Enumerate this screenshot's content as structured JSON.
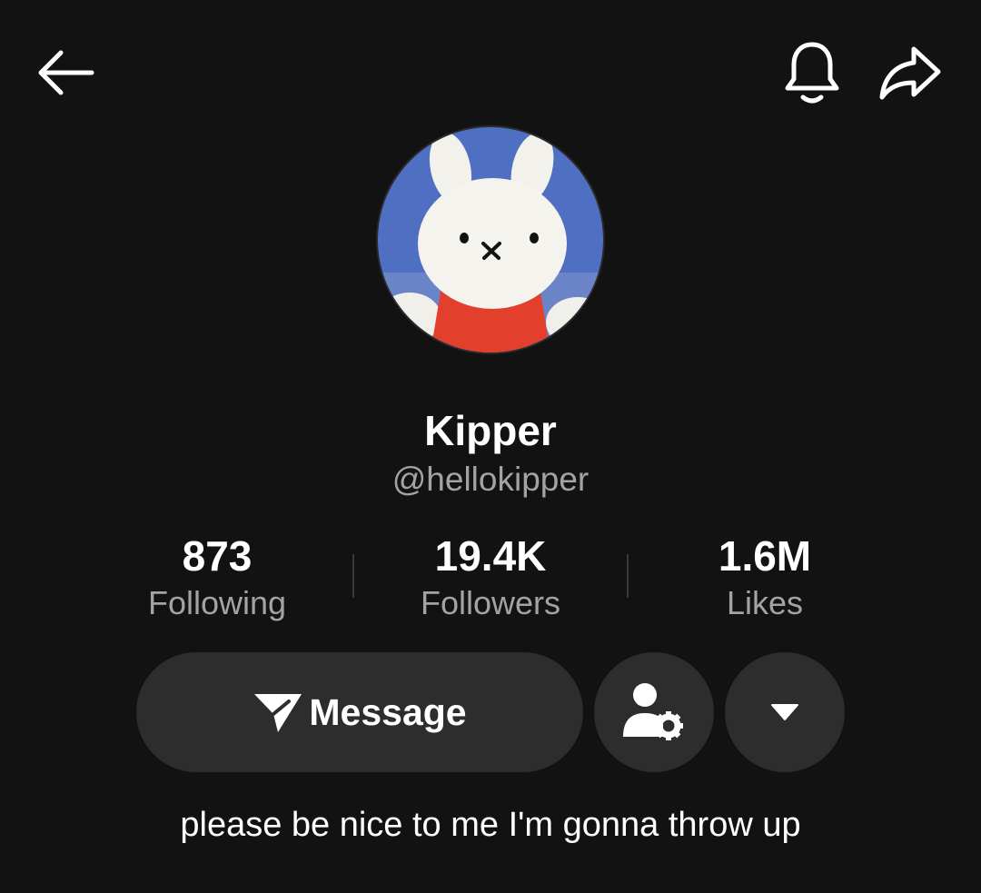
{
  "header": {
    "back_icon": "arrow-left-icon",
    "notification_icon": "bell-icon",
    "share_icon": "share-arrow-icon"
  },
  "profile": {
    "avatar_description": "avatar-image",
    "display_name": "Kipper",
    "username": "@hellokipper",
    "bio": "please be nice to me I'm gonna throw up"
  },
  "stats": [
    {
      "value": "873",
      "label": "Following"
    },
    {
      "value": "19.4K",
      "label": "Followers"
    },
    {
      "value": "1.6M",
      "label": "Likes"
    }
  ],
  "actions": {
    "message_label": "Message",
    "message_icon": "paper-plane-icon",
    "user_settings_icon": "user-gear-icon",
    "more_icon": "caret-down-icon"
  },
  "colors": {
    "background": "#121212",
    "button_bg": "#2d2d2d",
    "secondary_text": "#a3a3a3"
  }
}
